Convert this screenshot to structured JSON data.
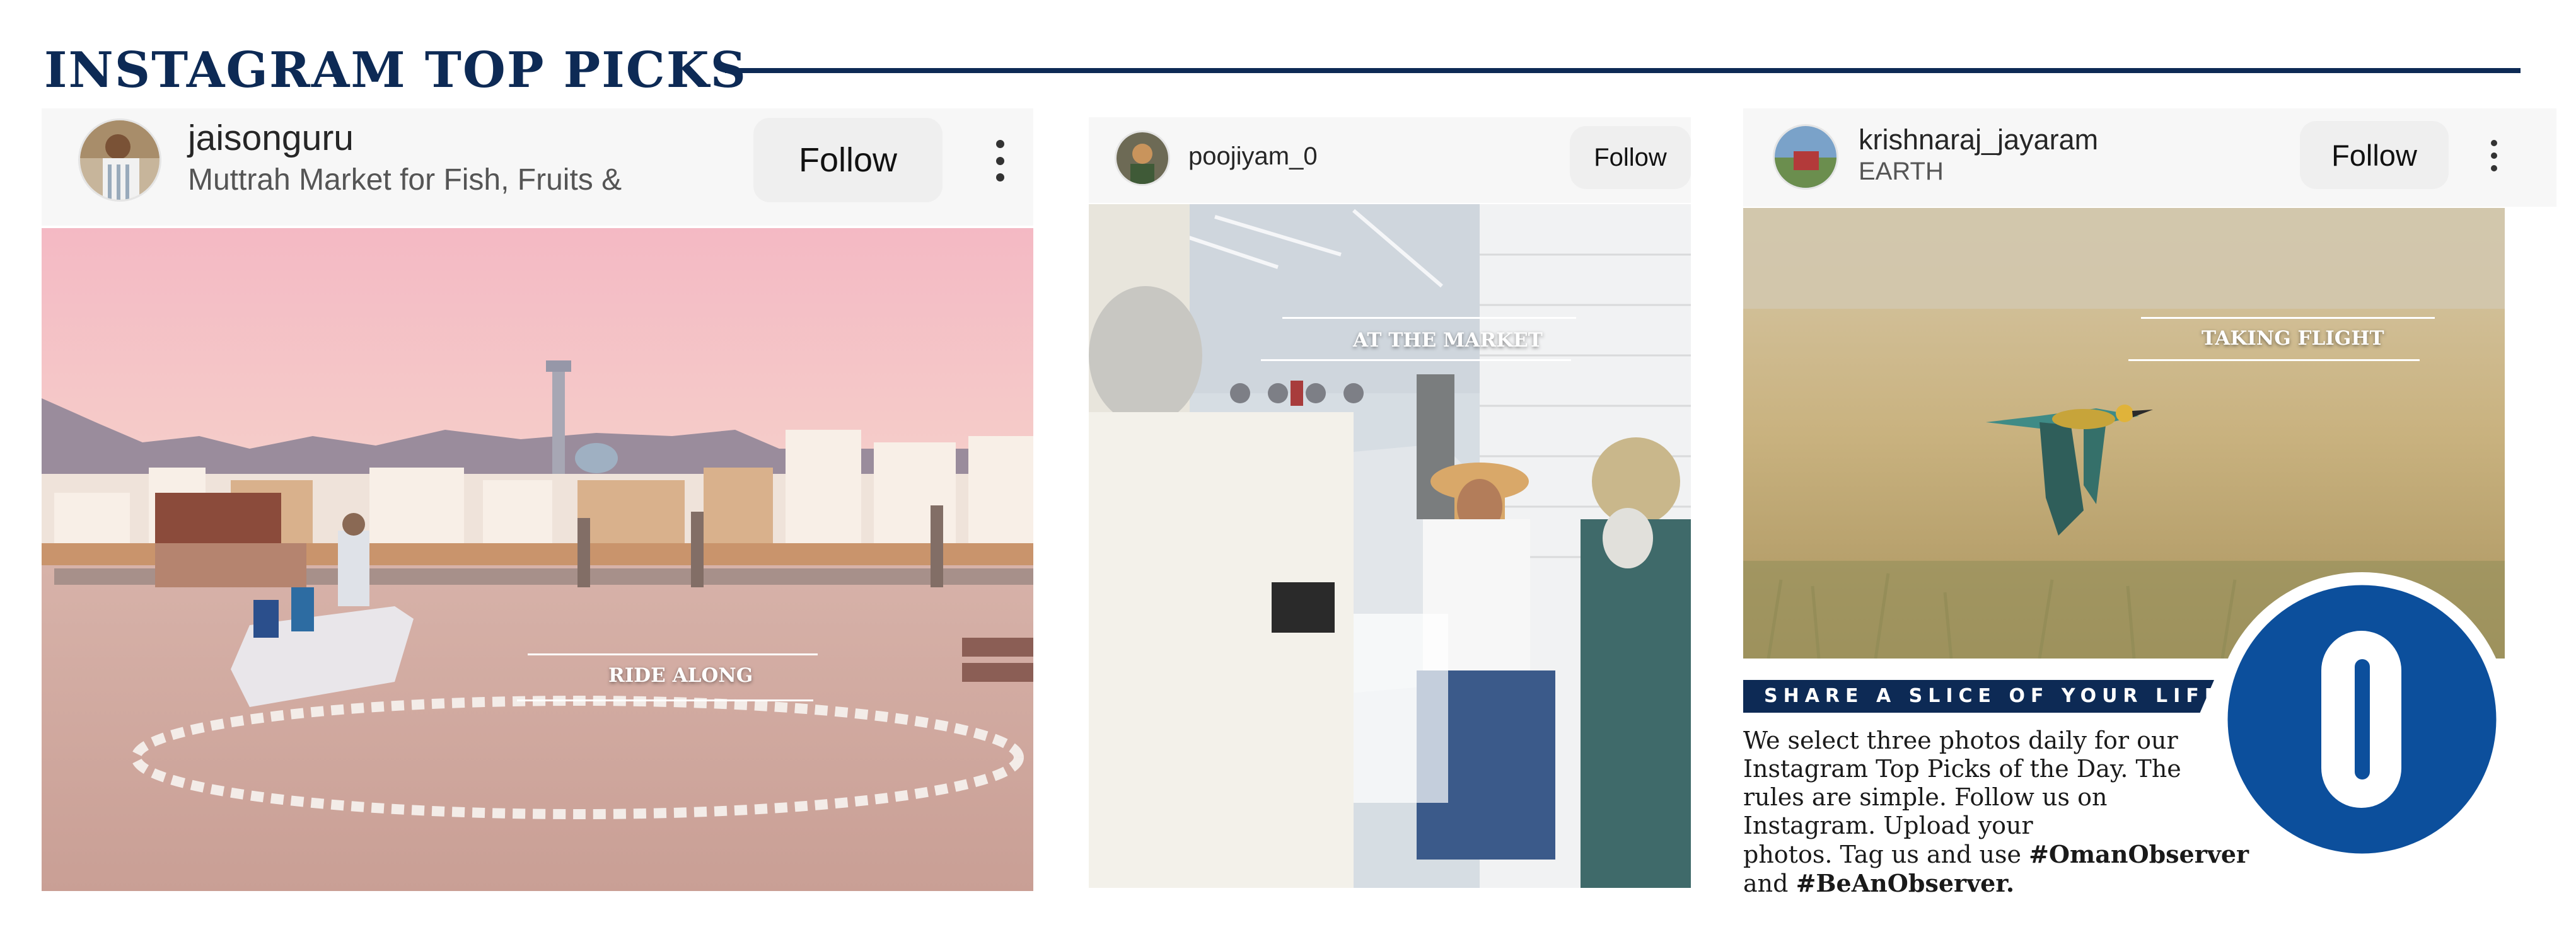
{
  "header": {
    "title": "INSTAGRAM TOP PICKS"
  },
  "posts": [
    {
      "username": "jaisonguru",
      "location": "Muttrah Market for Fish, Fruits &",
      "follow_label": "Follow",
      "caption": "RIDE ALONG"
    },
    {
      "username": "poojiyam_0",
      "location": "",
      "follow_label": "Follow",
      "caption": "AT THE MARKET"
    },
    {
      "username": "krishnaraj_jayaram",
      "location": "EARTH",
      "follow_label": "Follow",
      "caption": "TAKING FLIGHT"
    }
  ],
  "sidebar": {
    "banner": "SHARE A SLICE OF YOUR LIFE",
    "body_lines": [
      "We select three photos daily for our",
      "Instagram Top Picks of the Day. The",
      "rules are simple. Follow us on",
      "Instagram. Upload your",
      "photos. Tag us and use"
    ],
    "hashtag1": "#OmanObserver",
    "and_text": "and",
    "hashtag2": "#BeAnObserver.",
    "logo_letter": "O"
  },
  "colors": {
    "brand_navy": "#0d2a55",
    "logo_blue": "#0c4f9c"
  },
  "icons": [
    "more-vertical-icon",
    "avatar"
  ]
}
